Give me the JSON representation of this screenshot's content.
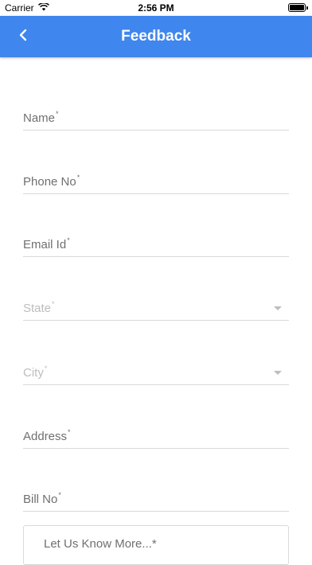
{
  "status_bar": {
    "carrier": "Carrier",
    "time": "2:56 PM",
    "battery_level": 1.0
  },
  "nav": {
    "title": "Feedback",
    "back_icon": "chevron-left-icon"
  },
  "form": {
    "name_label": "Name",
    "phone_label": "Phone No",
    "email_label": "Email Id",
    "state_label": "State",
    "city_label": "City",
    "address_label": "Address",
    "bill_label": "Bill No",
    "required_mark": "*",
    "more_placeholder": "Let Us Know More...*"
  },
  "colors": {
    "nav_background": "#3f86ee",
    "label": "#707070",
    "disabled_label": "#bdbdbd",
    "divider": "#d9d9d9"
  }
}
